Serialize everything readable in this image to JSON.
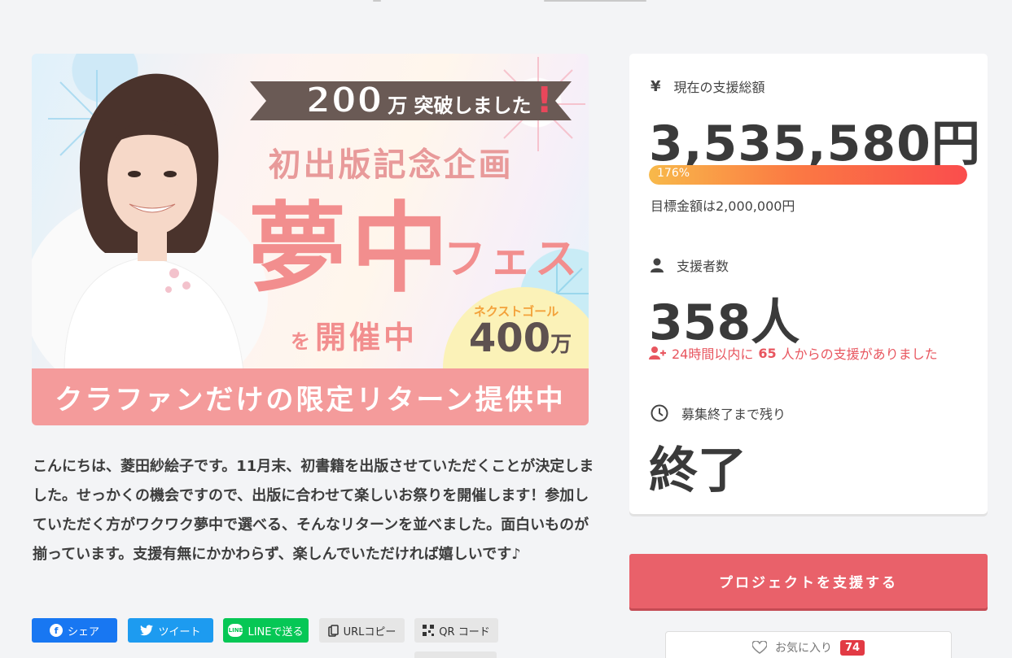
{
  "hero": {
    "ribbon_number": "200",
    "ribbon_text": "万 突破しました",
    "ribbon_excl": "!",
    "sub_title": "初出版記念企画",
    "main_title_big": "夢中",
    "main_title_small": "フェス",
    "open_wo": "を",
    "open_text": "開催中",
    "next_goal_label": "ネクストゴール",
    "next_goal_value": "400",
    "next_goal_unit": "万",
    "band_text": "クラファンだけの限定リターン提供中"
  },
  "description": "こんにちは、菱田紗絵子です。11月末、初書籍を出版させていただくことが決定しました。せっかくの機会ですので、出版に合わせて楽しいお祭りを開催します！参加していただく方がワクワク夢中で選べる、そんなリターンを並べました。面白いものが揃っています。支援有無にかかわらず、楽しんでいただければ嬉しいです♪",
  "share": {
    "facebook": "シェア",
    "twitter": "ツイート",
    "line": "LINEで送る",
    "url_copy": "URLコピー",
    "qr": "QR コード"
  },
  "stats": {
    "amount_label": "現在の支援総額",
    "amount_value": "3,535,580円",
    "progress_text": "176%",
    "progress_fraction": 1.0,
    "goal_text": "目標金額は2,000,000円",
    "backers_label": "支援者数",
    "backers_value": "358人",
    "recent_prefix": "24時間以内に",
    "recent_count": "65",
    "recent_suffix": "人からの支援がありました",
    "remaining_label": "募集終了まで残り",
    "remaining_value": "終了"
  },
  "cta": {
    "label": "プロジェクトを支援する"
  },
  "favorite": {
    "label": "お気に入り",
    "count": "74"
  },
  "colors": {
    "accent": "#e9616a",
    "alert": "#e8565f",
    "facebook": "#1877f2",
    "twitter": "#1d9bf0",
    "line": "#06c755"
  }
}
